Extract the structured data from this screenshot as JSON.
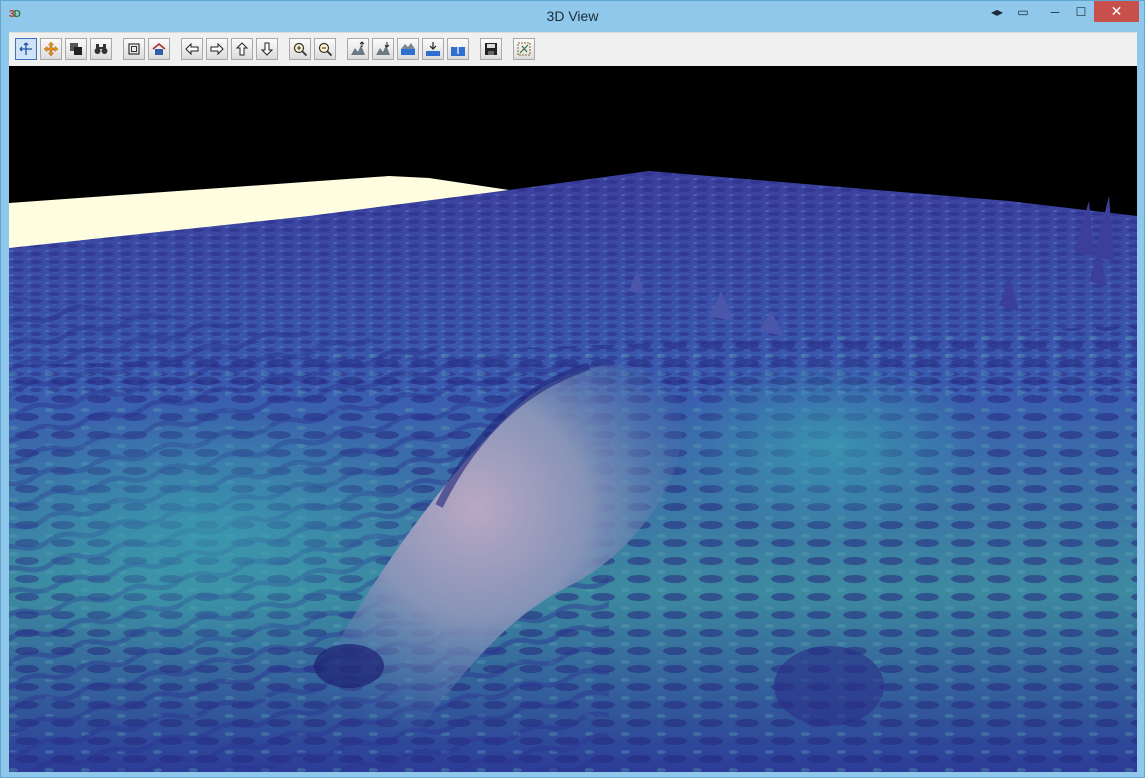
{
  "window": {
    "title": "3D View",
    "app_icon_text_a": "3",
    "app_icon_text_b": "D"
  },
  "title_controls": [
    {
      "name": "window-arrows-button",
      "glyph": "◂▸"
    },
    {
      "name": "window-pin-button",
      "glyph": "▭"
    },
    {
      "name": "minimize-button",
      "glyph": "─"
    },
    {
      "name": "maximize-button",
      "glyph": "☐"
    },
    {
      "name": "close-button",
      "glyph": "✕"
    }
  ],
  "toolbar": [
    {
      "name": "rotate-tool-button",
      "icon": "rotate-icon",
      "active": true
    },
    {
      "name": "pan-tool-button",
      "icon": "pan-move-icon"
    },
    {
      "name": "layers-button",
      "icon": "layers-icon"
    },
    {
      "name": "binoculars-button",
      "icon": "binoculars-icon"
    },
    {
      "name": "fit-view-button",
      "icon": "fit-view-icon"
    },
    {
      "name": "home-view-button",
      "icon": "home-icon"
    },
    {
      "name": "move-left-button",
      "icon": "arrow-left-icon"
    },
    {
      "name": "move-right-button",
      "icon": "arrow-right-icon"
    },
    {
      "name": "move-up-button",
      "icon": "arrow-up-icon"
    },
    {
      "name": "move-down-button",
      "icon": "arrow-down-icon"
    },
    {
      "name": "zoom-in-button",
      "icon": "zoom-in-icon"
    },
    {
      "name": "zoom-out-button",
      "icon": "zoom-out-icon"
    },
    {
      "name": "vertical-exaggeration-up-button",
      "icon": "terrain-up-icon"
    },
    {
      "name": "vertical-exaggeration-down-button",
      "icon": "terrain-down-icon"
    },
    {
      "name": "water-level-button",
      "icon": "water-level-icon"
    },
    {
      "name": "lower-water-button",
      "icon": "water-lower-icon"
    },
    {
      "name": "raise-water-button",
      "icon": "water-raise-icon"
    },
    {
      "name": "save-button",
      "icon": "save-icon"
    },
    {
      "name": "settings-button",
      "icon": "settings-icon"
    }
  ],
  "colors": {
    "titlebar": "#8fc8ea",
    "sky": "#000000",
    "terrain_base": "#3b4fa6",
    "terrain_highlight": "#3f8f9a",
    "plateau": "#fffde0",
    "close_button": "#c7504d"
  }
}
